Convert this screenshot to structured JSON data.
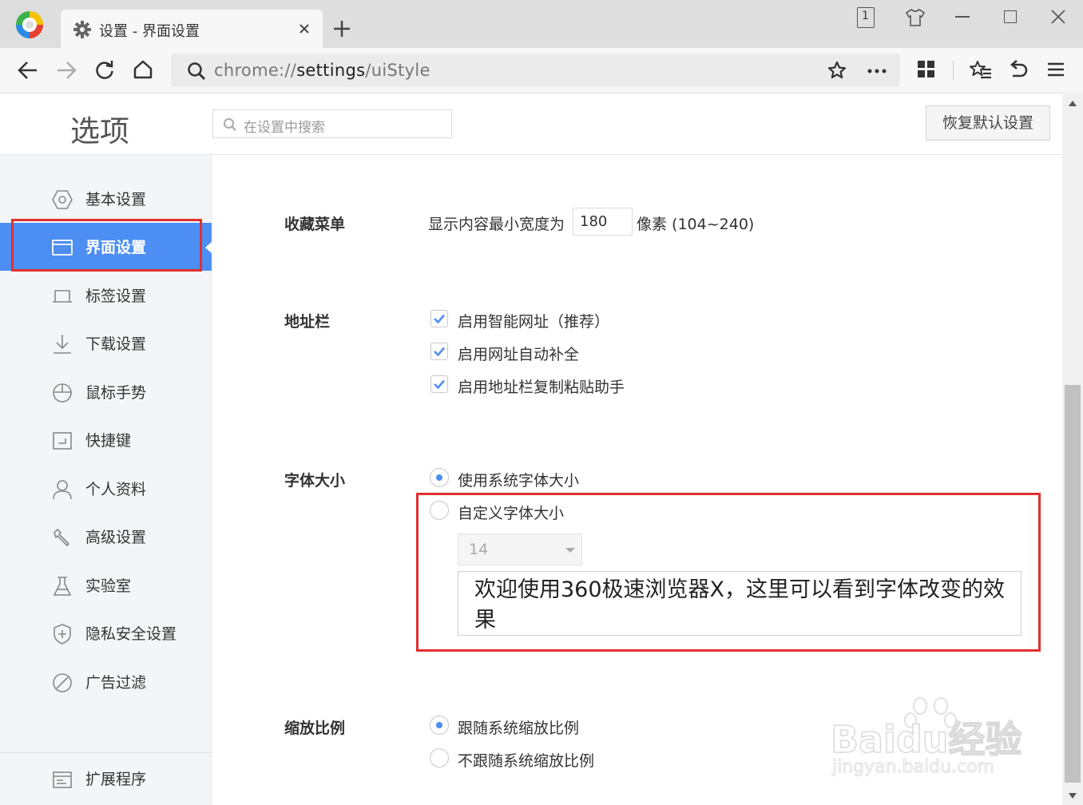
{
  "browser": {
    "tab_title": "设置 - 界面设置",
    "url_scheme": "chrome://",
    "url_host": "settings",
    "url_path": "/uiStyle",
    "window_badge": "1"
  },
  "header": {
    "title": "选项",
    "search_placeholder": "在设置中搜索",
    "reset_label": "恢复默认设置"
  },
  "sidebar": {
    "items": [
      {
        "label": "基本设置",
        "icon": "gear-hex-icon"
      },
      {
        "label": "界面设置",
        "icon": "window-icon"
      },
      {
        "label": "标签设置",
        "icon": "tab-icon"
      },
      {
        "label": "下载设置",
        "icon": "download-icon"
      },
      {
        "label": "鼠标手势",
        "icon": "mouse-icon"
      },
      {
        "label": "快捷键",
        "icon": "keyboard-shortcut-icon"
      },
      {
        "label": "个人资料",
        "icon": "person-icon"
      },
      {
        "label": "高级设置",
        "icon": "wrench-icon"
      },
      {
        "label": "实验室",
        "icon": "flask-icon"
      },
      {
        "label": "隐私安全设置",
        "icon": "shield-plus-icon"
      },
      {
        "label": "广告过滤",
        "icon": "block-icon"
      }
    ],
    "extensions_label": "扩展程序"
  },
  "sections": {
    "favorites": {
      "title": "收藏菜单",
      "prefix": "显示内容最小宽度为",
      "value": "180",
      "suffix": "像素 (104~240)"
    },
    "address_bar": {
      "title": "地址栏",
      "options": [
        {
          "label": "启用智能网址（推荐）",
          "checked": true
        },
        {
          "label": "启用网址自动补全",
          "checked": true
        },
        {
          "label": "启用地址栏复制粘贴助手",
          "checked": true
        }
      ]
    },
    "font_size": {
      "title": "字体大小",
      "option_system": "使用系统字体大小",
      "option_custom": "自定义字体大小",
      "selected": "system",
      "custom_size": "14",
      "preview_text": "欢迎使用360极速浏览器X，这里可以看到字体改变的效果"
    },
    "zoom": {
      "title": "缩放比例",
      "option_follow": "跟随系统缩放比例",
      "option_not_follow": "不跟随系统缩放比例",
      "selected": "follow"
    }
  },
  "watermark": {
    "brand": "Baidu经验",
    "url": "jingyan.baidu.com"
  },
  "colors": {
    "accent": "#4d8ef3",
    "highlight_box": "#e0312f",
    "sidebar_bg": "#f3f5f8"
  }
}
